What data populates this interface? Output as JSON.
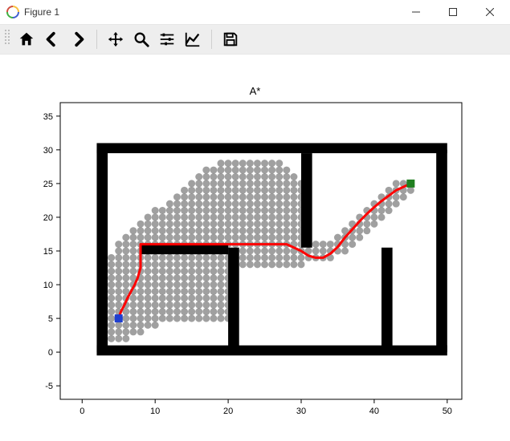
{
  "window": {
    "title": "Figure 1",
    "buttons": {
      "minimize": "Minimize",
      "maximize": "Maximize",
      "close": "Close"
    }
  },
  "toolbar": {
    "home": "Home",
    "back": "Back",
    "forward": "Forward",
    "pan": "Pan",
    "zoom": "Zoom",
    "configure": "Configure subplots",
    "edit": "Edit axis",
    "save": "Save"
  },
  "chart_data": {
    "type": "scatter",
    "title": "A*",
    "xlabel": "",
    "ylabel": "",
    "xlim": [
      -3,
      52
    ],
    "ylim": [
      -7,
      37
    ],
    "xticks": [
      0,
      10,
      20,
      30,
      40,
      50
    ],
    "yticks": [
      -5,
      0,
      5,
      10,
      15,
      20,
      25,
      30,
      35
    ],
    "walls": [
      {
        "x": 2,
        "y": -0.5,
        "w": 48,
        "h": 1.5
      },
      {
        "x": 2,
        "y": 29.5,
        "w": 48,
        "h": 1.5
      },
      {
        "x": 2,
        "y": 0,
        "w": 1.5,
        "h": 30
      },
      {
        "x": 48.5,
        "y": 0,
        "w": 1.5,
        "h": 30
      },
      {
        "x": 8,
        "y": 14.5,
        "w": 12,
        "h": 1.5
      },
      {
        "x": 20,
        "y": 0,
        "w": 1.5,
        "h": 15.5
      },
      {
        "x": 30,
        "y": 15.5,
        "w": 1.5,
        "h": 14
      },
      {
        "x": 41,
        "y": 0,
        "w": 1.5,
        "h": 15.5
      }
    ],
    "start": {
      "x": 5,
      "y": 5,
      "color": "#1f3fd0"
    },
    "goal": {
      "x": 45,
      "y": 25,
      "color": "#1f7f1f"
    },
    "path": {
      "color": "#ff0000",
      "points": [
        [
          5,
          5
        ],
        [
          5.3,
          6
        ],
        [
          5.8,
          7
        ],
        [
          6.2,
          8
        ],
        [
          6.7,
          9
        ],
        [
          7.2,
          10
        ],
        [
          7.6,
          11
        ],
        [
          8,
          12.5
        ],
        [
          8,
          14
        ],
        [
          8,
          15.5
        ],
        [
          8,
          16
        ],
        [
          10,
          16
        ],
        [
          12,
          16
        ],
        [
          14,
          16
        ],
        [
          16,
          16
        ],
        [
          18,
          16
        ],
        [
          20,
          16
        ],
        [
          22,
          16
        ],
        [
          24,
          16
        ],
        [
          26,
          16
        ],
        [
          28,
          16
        ],
        [
          29,
          15.5
        ],
        [
          30,
          15
        ],
        [
          31,
          14.3
        ],
        [
          32,
          14
        ],
        [
          33,
          14
        ],
        [
          34,
          14.6
        ],
        [
          35,
          15.6
        ],
        [
          36,
          17
        ],
        [
          37,
          18.2
        ],
        [
          38,
          19.4
        ],
        [
          39,
          20.5
        ],
        [
          40,
          21.5
        ],
        [
          41,
          22.4
        ],
        [
          42,
          23.2
        ],
        [
          43,
          24
        ],
        [
          44,
          24.5
        ],
        [
          45,
          25
        ]
      ]
    },
    "explored_rows": [
      {
        "y": 2,
        "x0": 3,
        "x1": 6
      },
      {
        "y": 3,
        "x0": 3,
        "x1": 8
      },
      {
        "y": 4,
        "x0": 3,
        "x1": 10
      },
      {
        "y": 5,
        "x0": 3,
        "x1": 20
      },
      {
        "y": 6,
        "x0": 3,
        "x1": 20
      },
      {
        "y": 7,
        "x0": 3,
        "x1": 20
      },
      {
        "y": 8,
        "x0": 3,
        "x1": 20
      },
      {
        "y": 9,
        "x0": 3,
        "x1": 20
      },
      {
        "y": 10,
        "x0": 3,
        "x1": 20
      },
      {
        "y": 11,
        "x0": 3,
        "x1": 20
      },
      {
        "y": 12,
        "x0": 3,
        "x1": 20
      },
      {
        "y": 13,
        "x0": 4,
        "x1": 30
      },
      {
        "y": 14,
        "x0": 4,
        "x1": 34
      },
      {
        "y": 15,
        "x0": 5,
        "x1": 36
      },
      {
        "y": 16,
        "x0": 5,
        "x1": 37
      },
      {
        "y": 17,
        "x0": 6,
        "x1": 30
      },
      {
        "y": 18,
        "x0": 7,
        "x1": 30
      },
      {
        "y": 19,
        "x0": 8,
        "x1": 30
      },
      {
        "y": 20,
        "x0": 9,
        "x1": 30
      },
      {
        "y": 21,
        "x0": 10,
        "x1": 30
      },
      {
        "y": 22,
        "x0": 12,
        "x1": 30
      },
      {
        "y": 23,
        "x0": 13,
        "x1": 30
      },
      {
        "y": 24,
        "x0": 14,
        "x1": 30
      },
      {
        "y": 25,
        "x0": 15,
        "x1": 30
      },
      {
        "y": 26,
        "x0": 16,
        "x1": 29
      },
      {
        "y": 27,
        "x0": 17,
        "x1": 28
      },
      {
        "y": 28,
        "x0": 19,
        "x1": 27
      },
      {
        "y": 17,
        "x0": 35,
        "x1": 38
      },
      {
        "y": 18,
        "x0": 36,
        "x1": 39
      },
      {
        "y": 19,
        "x0": 37,
        "x1": 40
      },
      {
        "y": 20,
        "x0": 38,
        "x1": 41
      },
      {
        "y": 21,
        "x0": 39,
        "x1": 42
      },
      {
        "y": 22,
        "x0": 40,
        "x1": 43
      },
      {
        "y": 23,
        "x0": 41,
        "x1": 44
      },
      {
        "y": 24,
        "x0": 42,
        "x1": 45
      },
      {
        "y": 25,
        "x0": 43,
        "x1": 45
      }
    ]
  }
}
